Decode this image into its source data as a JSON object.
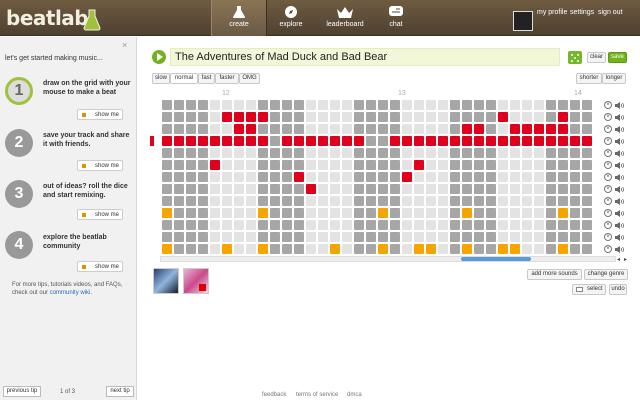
{
  "header": {
    "logo": "beatlab",
    "nav": [
      {
        "id": "create",
        "label": "create"
      },
      {
        "id": "explore",
        "label": "explore"
      },
      {
        "id": "leaderboard",
        "label": "leaderboard"
      },
      {
        "id": "chat",
        "label": "chat"
      }
    ],
    "links": {
      "profile": "my profile",
      "settings": "settings",
      "signout": "sign out"
    }
  },
  "sidebar": {
    "close": "×",
    "title": "let's get started making music...",
    "steps": [
      {
        "num": "1",
        "text": "draw on the grid with your mouse to make a beat",
        "button": "show me"
      },
      {
        "num": "2",
        "text": "save your track and share it with friends.",
        "button": "show me"
      },
      {
        "num": "3",
        "text": "out of ideas? roll the dice and start remixing.",
        "button": "show me"
      },
      {
        "num": "4",
        "text": "explore the beatlab community",
        "button": "show me"
      }
    ],
    "more_text": "For more tips, tutorials videos, and FAQs, check out our",
    "more_link": "community wiki",
    "more_end": ".",
    "prev": "previous tip",
    "count": "1 of 3",
    "next": "next tip"
  },
  "track": {
    "title": "The Adventures of Mad Duck and Bad Bear",
    "clear": "clear",
    "save": "save"
  },
  "speed": {
    "slow": "slow",
    "normal": "normal",
    "fast": "fast",
    "faster": "faster",
    "omg": "OMG"
  },
  "length": {
    "shorter": "shorter",
    "longer": "longer"
  },
  "ticks": [
    "12",
    "13",
    "14"
  ],
  "grid": {
    "colors": {
      "off_light": "#e3e3e3",
      "off_dark": "#a6a6a6",
      "red": "#e0001b",
      "orange": "#f5a400"
    },
    "rows": [
      "....................................",
      ".....RRRR...................R....R..",
      "......RR.................RR..RRRRR..",
      "RRRRRRRRR.RRRRRRR..RRRRRRRRRRRRRRRRR",
      "....................................",
      "....R................R..............",
      "...........R........R...............",
      "............R.......................",
      "....................................",
      "O.......O.........O......O.......O..",
      "....................................",
      "....................................",
      "O....O..O.....O...O..OO..O..OO...O.."
    ]
  },
  "actions": {
    "add_sounds": "add more sounds",
    "change_genre": "change genre",
    "select": "select",
    "undo": "undo"
  },
  "footer": {
    "feedback": "feedback",
    "terms": "terms of service",
    "dmca": "dmca"
  }
}
